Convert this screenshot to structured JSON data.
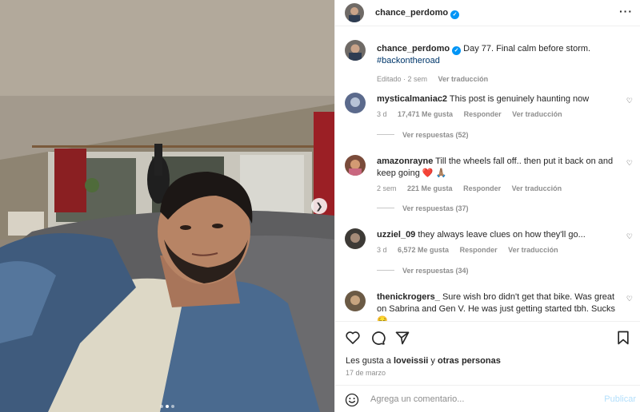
{
  "post": {
    "author": "chance_perdomo",
    "verified_mark": "✓",
    "caption_text": "Day 77. Final calm before storm.",
    "caption_hashtag": "#backontheroad",
    "caption_meta": {
      "edited": "Editado · 2 sem",
      "translate": "Ver traducción"
    },
    "carousel": {
      "next_icon": "chevron-right-icon",
      "pages": 3,
      "current": 2
    }
  },
  "comments": [
    {
      "user": "mysticalmaniac2",
      "text": "This post is genuinely haunting now",
      "time": "3 d",
      "likes": "17,471 Me gusta",
      "reply": "Responder",
      "translate": "Ver traducción",
      "replies": "Ver respuestas (52)",
      "avatar_color": "#5b6a8c"
    },
    {
      "user": "amazonrayne",
      "text": "Till the wheels fall off.. then put it back on and keep going ❤️ 🙏🏽",
      "time": "2 sem",
      "likes": "221 Me gusta",
      "reply": "Responder",
      "translate": "Ver traducción",
      "replies": "Ver respuestas (37)",
      "avatar_color": "#7a4b3a"
    },
    {
      "user": "uzziel_09",
      "text": "they always leave clues on how they'll go...",
      "time": "3 d",
      "likes": "6,572 Me gusta",
      "reply": "Responder",
      "translate": "Ver traducción",
      "replies": "Ver respuestas (34)",
      "avatar_color": "#3d3a36"
    },
    {
      "user": "thenickrogers_",
      "text": "Sure wish bro didn't get that bike. Was great on Sabrina and Gen V. He was just getting started tbh. Sucks 😔",
      "time": "",
      "likes": "",
      "reply": "",
      "translate": "",
      "replies": "",
      "avatar_color": "#6b5a45"
    }
  ],
  "actions": {
    "like_icon": "heart-icon",
    "comment_icon": "comment-icon",
    "share_icon": "share-icon",
    "save_icon": "bookmark-icon"
  },
  "likes_line": {
    "prefix": "Les gusta a",
    "user": "loveissii",
    "connector": "y",
    "others": "otras personas"
  },
  "date": "17 de marzo",
  "add_comment": {
    "placeholder": "Agrega un comentario...",
    "publish": "Publicar",
    "emoji_icon": "smiley-icon"
  },
  "colors": {
    "accent": "#0095f6",
    "publish_disabled": "#b2dffc",
    "hashtag": "#00376b",
    "heart_red": "#e0245e"
  }
}
